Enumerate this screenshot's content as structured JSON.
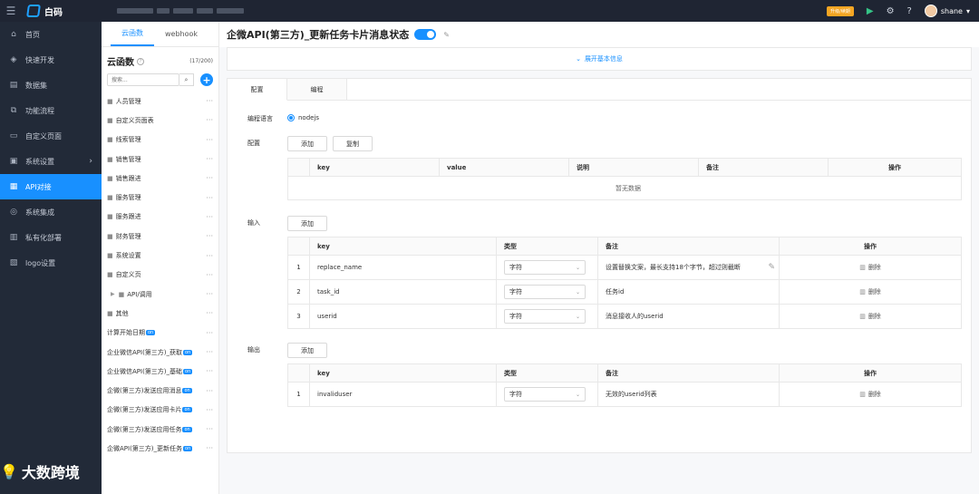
{
  "topbar": {
    "app_name": "白码",
    "upgrade_label": "升级/续期",
    "user_name": "shane",
    "user_caret": "▾"
  },
  "leftnav": {
    "items": [
      {
        "label": "首页",
        "icon": "home-icon"
      },
      {
        "label": "快速开发",
        "icon": "cube-icon"
      },
      {
        "label": "数据集",
        "icon": "database-icon"
      },
      {
        "label": "功能流程",
        "icon": "flow-icon"
      },
      {
        "label": "自定义页面",
        "icon": "page-icon"
      },
      {
        "label": "系统设置",
        "icon": "settings-icon",
        "has_submenu": true
      },
      {
        "label": "API对接",
        "icon": "api-icon",
        "active": true
      },
      {
        "label": "系统集成",
        "icon": "integration-icon"
      },
      {
        "label": "私有化部署",
        "icon": "server-icon"
      },
      {
        "label": "logo设置",
        "icon": "image-icon"
      }
    ]
  },
  "functions": {
    "tabs": [
      "云函数",
      "webhook"
    ],
    "active_tab": 0,
    "title": "云函数",
    "count": "(17/200)",
    "search_placeholder": "搜索...",
    "more": "···",
    "on_badge": "on",
    "items": [
      {
        "label": "人员管理",
        "folder": true
      },
      {
        "label": "自定义页面表",
        "folder": true
      },
      {
        "label": "线索管理",
        "folder": true
      },
      {
        "label": "销售管理",
        "folder": true
      },
      {
        "label": "销售跟进",
        "folder": true
      },
      {
        "label": "服务管理",
        "folder": true
      },
      {
        "label": "服务跟进",
        "folder": true
      },
      {
        "label": "财务管理",
        "folder": true
      },
      {
        "label": "系统设置",
        "folder": true
      },
      {
        "label": "自定义页",
        "folder": true
      },
      {
        "label": "API/调用",
        "folder": true,
        "expandable": true
      },
      {
        "label": "其他",
        "folder": true
      },
      {
        "label": "计算开始日期",
        "on": true
      },
      {
        "label": "企业微信API(第三方)_获取",
        "on": true
      },
      {
        "label": "企业微信API(第三方)_基础",
        "on": true
      },
      {
        "label": "企微(第三方)发送应用消息",
        "on": true
      },
      {
        "label": "企微(第三方)发送应用卡片",
        "on": true
      },
      {
        "label": "企微(第三方)发送应用任务",
        "on": true
      },
      {
        "label": "企微API(第三方)_更新任务",
        "on": true
      }
    ]
  },
  "main": {
    "title": "企微API(第三方)_更新任务卡片消息状态",
    "enabled": true,
    "expand_label": "展开基本信息",
    "tabs": [
      "配置",
      "编程"
    ],
    "active_tab": 0,
    "language_label": "编程语言",
    "language_value": "nodejs",
    "config": {
      "label": "配置",
      "add_label": "添加",
      "copy_label": "复制",
      "columns": [
        "key",
        "value",
        "说明",
        "备注",
        "操作"
      ],
      "empty_text": "暂无数据"
    },
    "input": {
      "label": "输入",
      "add_label": "添加",
      "columns": [
        "",
        "key",
        "类型",
        "备注",
        "操作"
      ],
      "rows": [
        {
          "num": "1",
          "key": "replace_name",
          "type": "字符",
          "note": "设置替换文案，最长支持18个字节，超过则截断",
          "action": "删除"
        },
        {
          "num": "2",
          "key": "task_id",
          "type": "字符",
          "note": "任务id",
          "action": "删除"
        },
        {
          "num": "3",
          "key": "userid",
          "type": "字符",
          "note": "消息接收人的userid",
          "action": "删除"
        }
      ]
    },
    "output": {
      "label": "输出",
      "add_label": "添加",
      "columns": [
        "",
        "key",
        "类型",
        "备注",
        "操作"
      ],
      "rows": [
        {
          "num": "1",
          "key": "invaliduser",
          "type": "字符",
          "note": "无效的userid列表",
          "action": "删除"
        }
      ]
    }
  },
  "watermark": "大数跨境"
}
